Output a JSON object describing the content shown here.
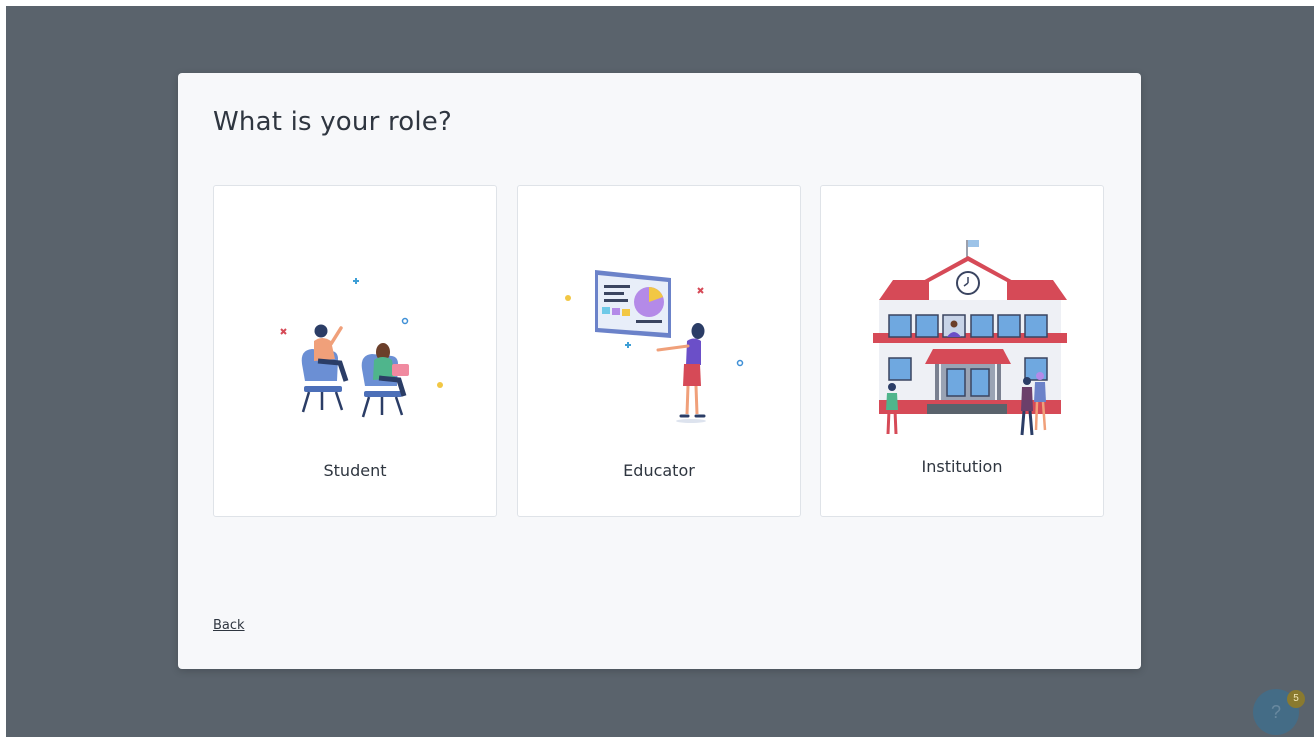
{
  "modal": {
    "title": "What is your role?",
    "back_label": "Back"
  },
  "roles": [
    {
      "label": "Student",
      "illustration": "students-in-chairs-illustration"
    },
    {
      "label": "Educator",
      "illustration": "presenter-with-screen-illustration"
    },
    {
      "label": "Institution",
      "illustration": "school-building-illustration"
    }
  ],
  "help": {
    "icon": "?",
    "badge_count": "5"
  },
  "colors": {
    "backdrop": "#5a636c",
    "modal_bg": "#f7f8fa",
    "card_border": "#dfe3e8",
    "roof_red": "#d64a57",
    "accent_blue": "#3e8fd6",
    "accent_yellow": "#f2c744"
  }
}
